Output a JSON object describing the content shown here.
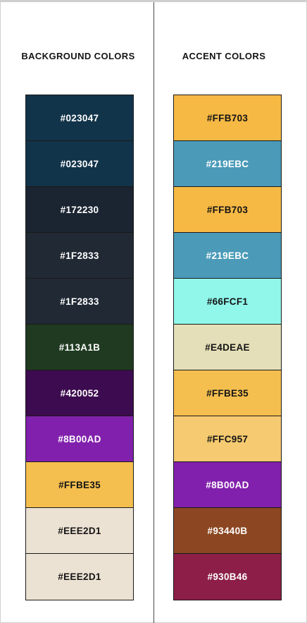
{
  "columns": {
    "background": {
      "title": "BACKGROUND COLORS",
      "swatches": [
        {
          "label": "#023047",
          "color": "#12344a",
          "text_color": "#ffffff"
        },
        {
          "label": "#023047",
          "color": "#12344a",
          "text_color": "#ffffff"
        },
        {
          "label": "#172230",
          "color": "#1b2431",
          "text_color": "#ffffff"
        },
        {
          "label": "#1F2833",
          "color": "#212934",
          "text_color": "#ffffff"
        },
        {
          "label": "#1F2833",
          "color": "#212934",
          "text_color": "#ffffff"
        },
        {
          "label": "#113A1B",
          "color": "#1f3a20",
          "text_color": "#ffffff"
        },
        {
          "label": "#420052",
          "color": "#3d0b4f",
          "text_color": "#ffffff"
        },
        {
          "label": "#8B00AD",
          "color": "#8120ac",
          "text_color": "#ffffff"
        },
        {
          "label": "#FFBE35",
          "color": "#f5bf4f",
          "text_color": "#141414"
        },
        {
          "label": "#EEE2D1",
          "color": "#ece2d3",
          "text_color": "#141414"
        },
        {
          "label": "#EEE2D1",
          "color": "#ece2d3",
          "text_color": "#141414"
        }
      ]
    },
    "accent": {
      "title": "ACCENT COLORS",
      "swatches": [
        {
          "label": "#FFB703",
          "color": "#f6b944",
          "text_color": "#141414"
        },
        {
          "label": "#219EBC",
          "color": "#4a9ab8",
          "text_color": "#ffffff"
        },
        {
          "label": "#FFB703",
          "color": "#f6b944",
          "text_color": "#141414"
        },
        {
          "label": "#219EBC",
          "color": "#4a9ab8",
          "text_color": "#ffffff"
        },
        {
          "label": "#66FCF1",
          "color": "#90f7ea",
          "text_color": "#141414"
        },
        {
          "label": "#E4DEAE",
          "color": "#e4dfb8",
          "text_color": "#141414"
        },
        {
          "label": "#FFBE35",
          "color": "#f5bf4f",
          "text_color": "#141414"
        },
        {
          "label": "#FFC957",
          "color": "#f6ca70",
          "text_color": "#141414"
        },
        {
          "label": "#8B00AD",
          "color": "#8120ac",
          "text_color": "#ffffff"
        },
        {
          "label": "#93440B",
          "color": "#8c4722",
          "text_color": "#ffffff"
        },
        {
          "label": "#930B46",
          "color": "#8c1e47",
          "text_color": "#ffffff"
        }
      ]
    }
  }
}
